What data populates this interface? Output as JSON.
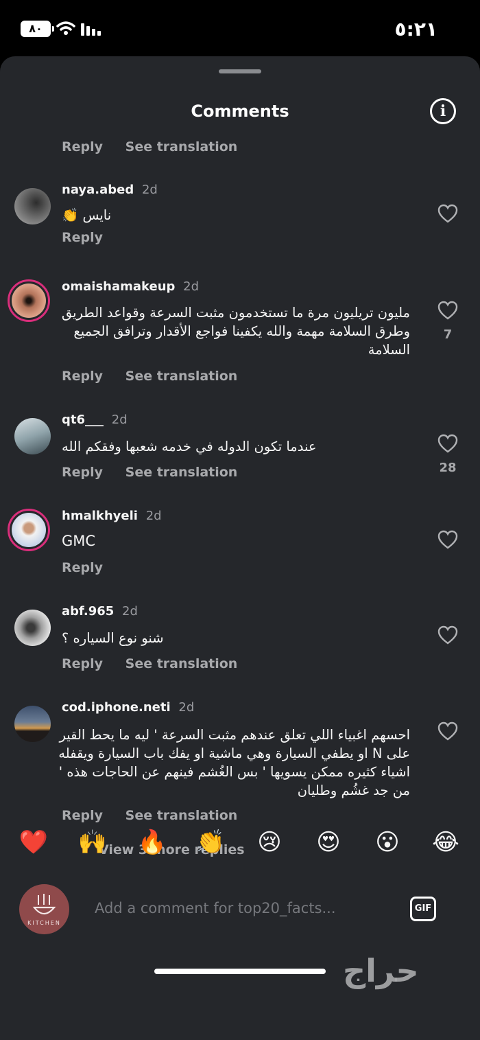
{
  "status_bar": {
    "battery": "٨٠",
    "time": "٥:٢١"
  },
  "sheet": {
    "title": "Comments",
    "top_actions": {
      "reply": "Reply",
      "see_translation": "See translation"
    }
  },
  "comments": [
    {
      "username": "naya.abed",
      "time": "2d",
      "text": "نايس 👏",
      "reply": "Reply",
      "likes": ""
    },
    {
      "username": "omaishamakeup",
      "time": "2d",
      "text": "مليون تريليون مرة ما تستخدمون مثبت السرعة وقواعد الطريق وطرق السلامة مهمة والله يكفينا فواجع الأقدار وترافق الجميع السلامة",
      "reply": "Reply",
      "see_translation": "See translation",
      "likes": "7"
    },
    {
      "username": "qt6___",
      "time": "2d",
      "text": "عندما تكون الدوله في خدمه شعبها وفقكم الله",
      "reply": "Reply",
      "see_translation": "See translation",
      "likes": "28"
    },
    {
      "username": "hmalkhyeli",
      "time": "2d",
      "text": "GMC",
      "reply": "Reply",
      "likes": ""
    },
    {
      "username": "abf.965",
      "time": "2d",
      "text": "شنو نوع السياره ؟",
      "reply": "Reply",
      "see_translation": "See translation",
      "likes": ""
    },
    {
      "username": "cod.iphone.neti",
      "time": "2d",
      "text": "احسهم اغبياء اللي تعلق عندهم مثبت السرعة ' ليه ما يحط القير على N او يطفي السيارة وهي ماشية او يفك باب السيارة ويقفله اشياء كثيره ممكن يسويها ' بس الغُشم فينهم عن الحاجات هذه ' من جد غشُم وطليان",
      "reply": "Reply",
      "see_translation": "See translation",
      "likes": ""
    }
  ],
  "view_more": "View 3 more replies",
  "emoji_bar": [
    "❤️",
    "🙌",
    "🔥",
    "👏",
    "😢",
    "😍",
    "😮",
    "😂"
  ],
  "composer": {
    "avatar_brand": "KITCHEN",
    "placeholder": "Add a comment for top20_facts...",
    "gif_label": "GIF"
  },
  "watermark": "حراج",
  "colors": {
    "sheet_bg": "#25272b",
    "story_ring": "#d92e7b",
    "muted_text": "#a8a9ac"
  }
}
